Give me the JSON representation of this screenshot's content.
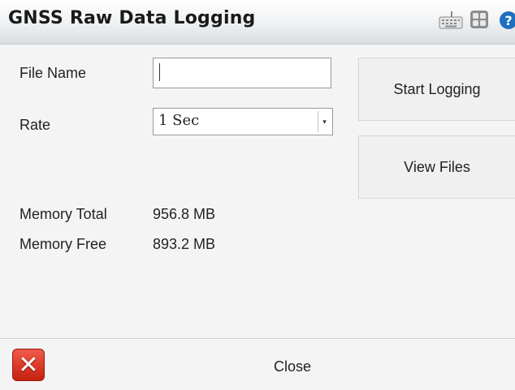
{
  "window": {
    "title": "GNSS Raw Data Logging"
  },
  "titlebar_icons": [
    "keyboard-icon",
    "grid-icon",
    "help-icon"
  ],
  "form": {
    "file_name_label": "File Name",
    "file_name_value": "",
    "rate_label": "Rate",
    "rate_value": "1 Sec"
  },
  "memory": {
    "total_label": "Memory Total",
    "total_value": "956.8 MB",
    "free_label": "Memory Free",
    "free_value": "893.2 MB"
  },
  "buttons": {
    "start_logging": "Start Logging",
    "view_files": "View Files"
  },
  "footer": {
    "close_label": "Close"
  },
  "colors": {
    "close_icon": "#d8321f",
    "help_icon": "#1d6fc0"
  }
}
